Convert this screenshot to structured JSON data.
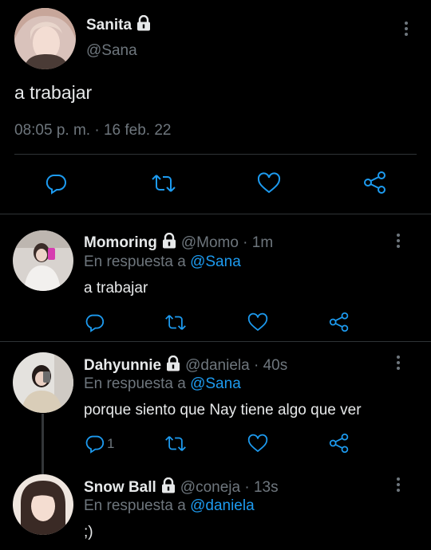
{
  "main_tweet": {
    "author_name": "Sanita",
    "author_handle": "@Sana",
    "text": "a trabajar",
    "timestamp": "08:05 p. m. · 16 feb. 22"
  },
  "replies": [
    {
      "author_name": "Momoring",
      "handle_time": "@Momo · 1m",
      "reply_prefix": "En respuesta a",
      "reply_to": "@Sana",
      "text": "a trabajar",
      "reply_count": ""
    },
    {
      "author_name": "Dahyunnie",
      "handle_time": "@daniela · 40s",
      "reply_prefix": "En respuesta a",
      "reply_to": "@Sana",
      "text": "porque siento que Nay tiene algo que ver",
      "reply_count": "1"
    },
    {
      "author_name": "Snow Ball",
      "handle_time": "@coneja · 13s",
      "reply_prefix": "En respuesta a",
      "reply_to": "@daniela",
      "text": ";)"
    }
  ],
  "colors": {
    "background": "#000000",
    "text": "#e7e9ea",
    "muted": "#6e767d",
    "link": "#1d9bf0",
    "divider": "#2f3336"
  },
  "icons": [
    "lock-icon",
    "more-icon",
    "reply-icon",
    "retweet-icon",
    "like-icon",
    "share-icon"
  ]
}
